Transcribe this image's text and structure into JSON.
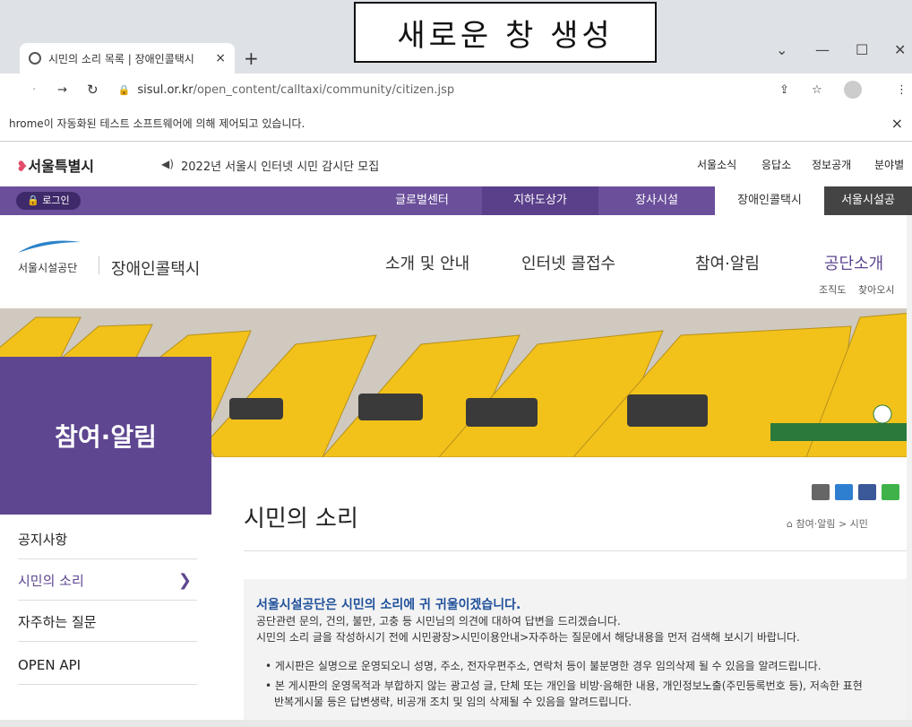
{
  "overlay_caption": "새로운 창 생성",
  "browser": {
    "tab_title": "시민의 소리 목록 | 장애인콜택시",
    "tab_close": "×",
    "new_tab": "+",
    "minimize": "—",
    "maximize": "☐",
    "close": "✕",
    "dropdown": "⌄",
    "url_host": "sisul.or.kr",
    "url_path": "/open_content/calltaxi/community/citizen.jsp",
    "infobar_text": "hrome이 자동화된 테스트 소프트웨어에 의해 제어되고 있습니다.",
    "infobar_close": "×"
  },
  "site": {
    "city_logo": "서울특별시",
    "ticker": "2022년 서울시 인터넷 시민 감시단 모집",
    "top_links": [
      "서울소식",
      "응답소",
      "정보공개",
      "분야별"
    ],
    "login": "로그인",
    "purple_nav": [
      "글로벌센터",
      "지하도상가",
      "장사시설",
      "장애인콜택시",
      "서울시설공"
    ],
    "org_logo": "서울시설공단",
    "service_name": "장애인콜택시",
    "main_menu": [
      "소개 및 안내",
      "인터넷 콜접수",
      "참여·알림",
      "공단소개"
    ],
    "sub_links": [
      "조직도",
      "찾아오시"
    ],
    "section_title": "참여·알림"
  },
  "sidebar": {
    "items": [
      "공지사항",
      "시민의 소리",
      "자주하는 질문",
      "OPEN API"
    ],
    "active_arrow": "❯"
  },
  "content": {
    "title": "시민의 소리",
    "breadcrumb": "참여·알림 > 시민",
    "notice_heading": "서울시설공단은 시민의 소리에 귀 귀울이겠습니다.",
    "notice_line1": "공단관련 문의, 건의, 불만, 고충 등 시민님의 의견에 대하여 답변을 드리겠습니다.",
    "notice_line2": "시민의 소리 글을 작성하시기 전에 시민광장>시민이용안내>자주하는 질문에서 해당내용을 먼저 검색해 보시기 바랍니다.",
    "bullet1": "게시판은 실명으로 운영되오니 성명, 주소, 전자우편주소, 연락처 등이 불분명한 경우 임의삭제 될 수 있음을 알려드립니다.",
    "bullet2": "본 게시판의 운영목적과 부합하지 않는 광고성 글, 단체 또는 개인을 비방·음해한 내용, 개인정보노출(주민등록번호 등), 저속한 표현",
    "bullet2_cont": "반복게시물 등은 답변생략, 비공개 조치 및 임의 삭제될 수 있음을 알려드립니다."
  },
  "colors": {
    "purple": "#6b4f9b",
    "sidebar_purple": "#5e4690",
    "taxi_yellow": "#f2c21b",
    "notice_blue": "#1e4f9a"
  }
}
